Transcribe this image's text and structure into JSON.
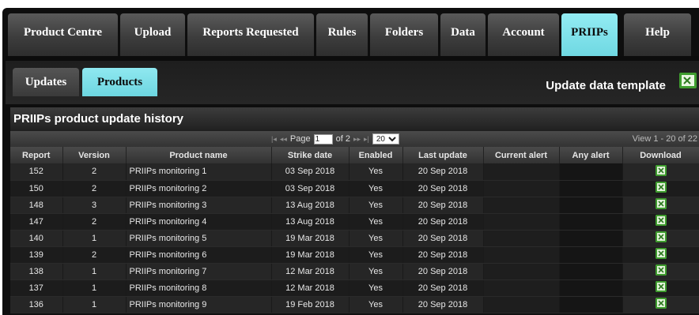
{
  "nav": {
    "tabs": [
      {
        "label": "Product Centre",
        "active": false
      },
      {
        "label": "Upload",
        "active": false
      },
      {
        "label": "Reports Requested",
        "active": false
      },
      {
        "label": "Rules",
        "active": false
      },
      {
        "label": "Folders",
        "active": false
      },
      {
        "label": "Data",
        "active": false
      },
      {
        "label": "Account",
        "active": false
      },
      {
        "label": "PRIIPs",
        "active": true
      },
      {
        "label": "Help",
        "active": false
      }
    ]
  },
  "subnav": {
    "tabs": [
      {
        "label": "Updates",
        "active": false
      },
      {
        "label": "Products",
        "active": true
      }
    ],
    "update_template_label": "Update data template",
    "update_template_icon": "excel-icon"
  },
  "grid": {
    "title": "PRIIPs product update history",
    "pager": {
      "page_label": "Page",
      "current_page": "1",
      "of_label": "of 2",
      "rows_per_page": "20",
      "view_text": "View 1 - 20 of 22"
    },
    "columns": [
      "Report",
      "Version",
      "Product name",
      "Strike date",
      "Enabled",
      "Last update",
      "Current alert",
      "Any alert",
      "Download"
    ],
    "rows": [
      {
        "report": "152",
        "version": "2",
        "name": "PRIIPs monitoring 1",
        "strike": "03 Sep 2018",
        "enabled": "Yes",
        "last": "20 Sep 2018",
        "current_alert": "",
        "any_alert": ""
      },
      {
        "report": "150",
        "version": "2",
        "name": "PRIIPs monitoring 2",
        "strike": "03 Sep 2018",
        "enabled": "Yes",
        "last": "20 Sep 2018",
        "current_alert": "",
        "any_alert": ""
      },
      {
        "report": "148",
        "version": "3",
        "name": "PRIIPs monitoring 3",
        "strike": "13 Aug 2018",
        "enabled": "Yes",
        "last": "20 Sep 2018",
        "current_alert": "",
        "any_alert": ""
      },
      {
        "report": "147",
        "version": "2",
        "name": "PRIIPs monitoring 4",
        "strike": "13 Aug 2018",
        "enabled": "Yes",
        "last": "20 Sep 2018",
        "current_alert": "",
        "any_alert": ""
      },
      {
        "report": "140",
        "version": "1",
        "name": "PRIIPs monitoring 5",
        "strike": "19 Mar 2018",
        "enabled": "Yes",
        "last": "20 Sep 2018",
        "current_alert": "",
        "any_alert": ""
      },
      {
        "report": "139",
        "version": "2",
        "name": "PRIIPs monitoring 6",
        "strike": "19 Mar 2018",
        "enabled": "Yes",
        "last": "20 Sep 2018",
        "current_alert": "",
        "any_alert": ""
      },
      {
        "report": "138",
        "version": "1",
        "name": "PRIIPs monitoring 7",
        "strike": "12 Mar 2018",
        "enabled": "Yes",
        "last": "20 Sep 2018",
        "current_alert": "",
        "any_alert": ""
      },
      {
        "report": "137",
        "version": "1",
        "name": "PRIIPs monitoring 8",
        "strike": "12 Mar 2018",
        "enabled": "Yes",
        "last": "20 Sep 2018",
        "current_alert": "",
        "any_alert": ""
      },
      {
        "report": "136",
        "version": "1",
        "name": "PRIIPs monitoring 9",
        "strike": "19 Feb 2018",
        "enabled": "Yes",
        "last": "20 Sep 2018",
        "current_alert": "",
        "any_alert": ""
      }
    ],
    "download_icon": "excel-download-icon"
  },
  "colors": {
    "active_tab": "#7fe1ea",
    "background": "#0e0e0e",
    "excel_green": "#3f9d2f"
  }
}
